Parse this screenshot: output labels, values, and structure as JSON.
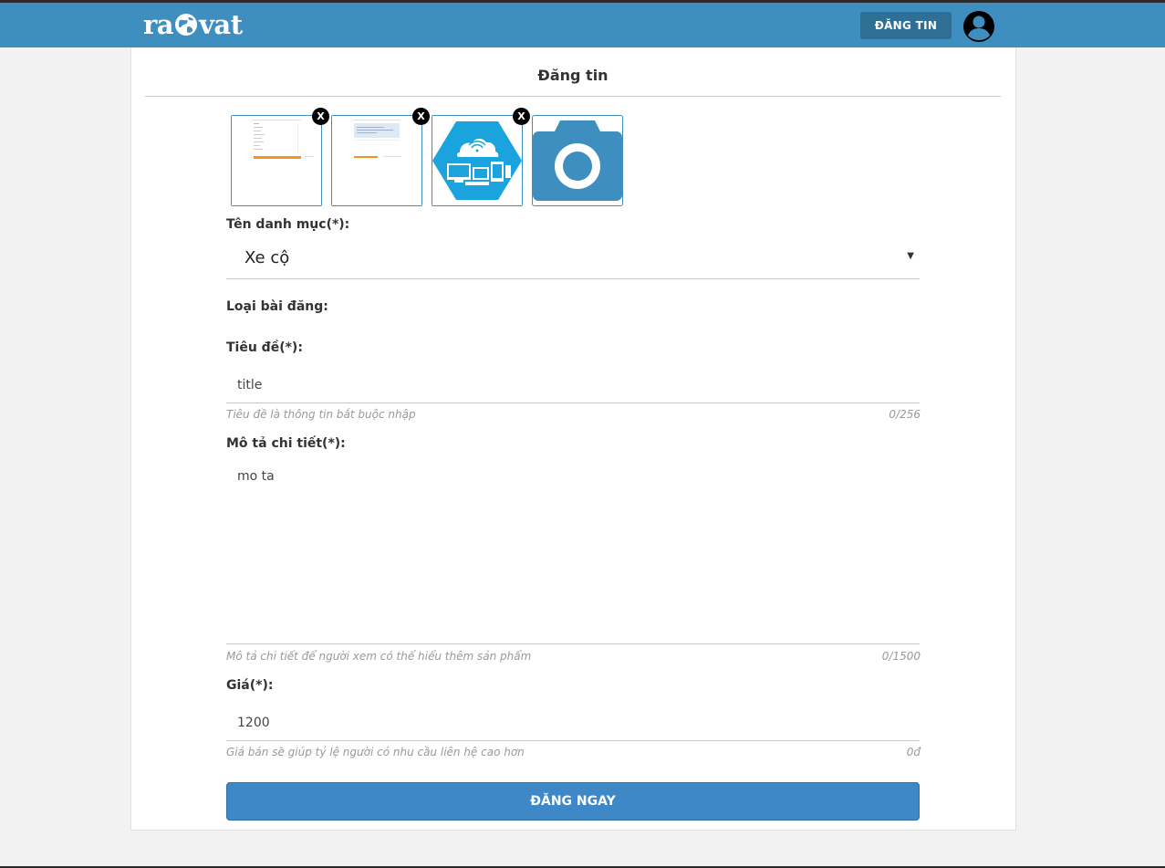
{
  "header": {
    "logo_left": "ra",
    "logo_right": "vat",
    "post_button": "ĐĂNG TIN",
    "brand_color": "#3e8ebf"
  },
  "form": {
    "title": "Đăng tin",
    "images": [
      {
        "kind": "screenshot-thumbnail",
        "remove": "X"
      },
      {
        "kind": "screenshot-thumbnail",
        "remove": "X"
      },
      {
        "kind": "cloud-devices-hexagon",
        "remove": "X"
      }
    ],
    "upload_icon": "camera-icon",
    "category_label": "Tên danh mục(*):",
    "category_value": "Xe cộ",
    "post_type_label": "Loại bài đăng:",
    "title_label": "Tiêu đề(*):",
    "title_value": "title",
    "title_hint": "Tiêu đề là thông tin bắt buộc nhập",
    "title_counter": "0/256",
    "description_label": "Mô tả chi tiết(*):",
    "description_value": "mo ta",
    "description_hint": "Mô tả chi tiết để người xem có thể hiểu thêm sản phẩm",
    "description_counter": "0/1500",
    "price_label": "Giá(*):",
    "price_value": "1200",
    "price_hint": "Giá bán sẽ giúp tỷ lệ người có nhu cầu liên hệ cao hơn",
    "price_counter": "0đ",
    "submit_button": "ĐĂNG NGAY"
  }
}
